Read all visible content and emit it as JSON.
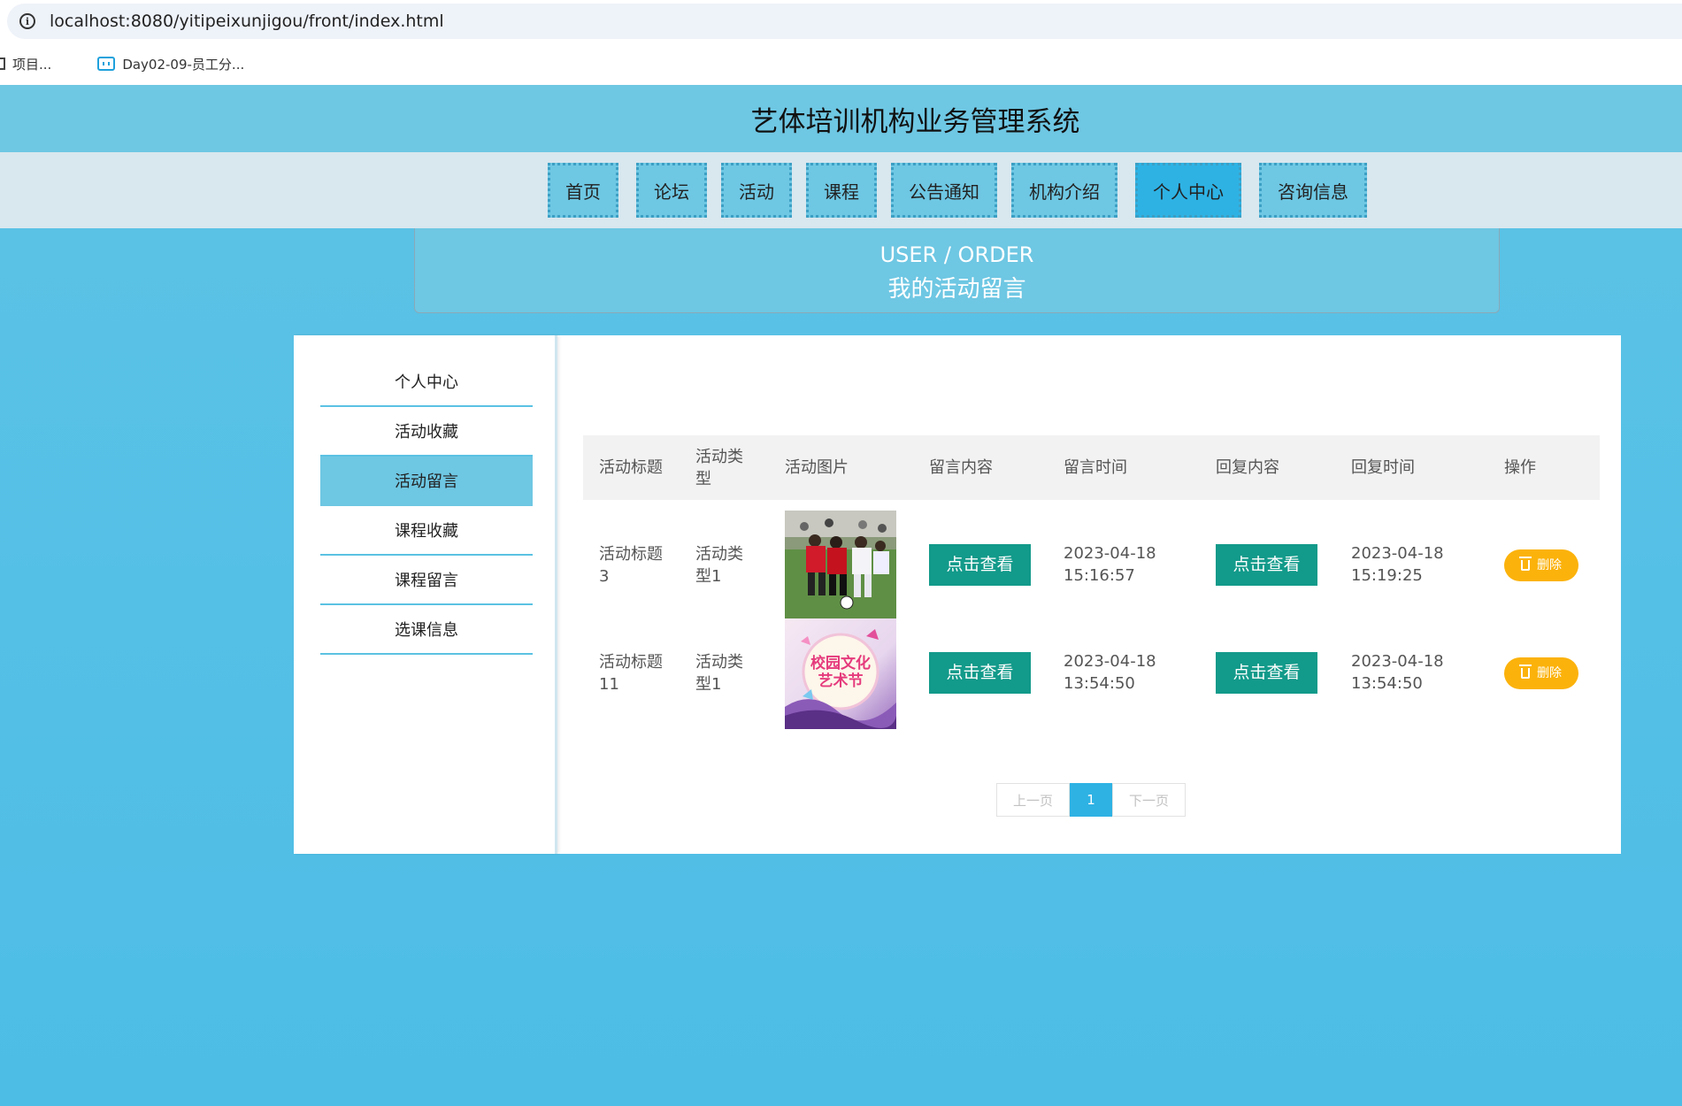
{
  "browser": {
    "url": "localhost:8080/yitipeixunjigou/front/index.html",
    "bookmarks": [
      "项目...",
      "Day02-09-员工分..."
    ]
  },
  "header": {
    "title": "艺体培训机构业务管理系统"
  },
  "nav": {
    "items": [
      "首页",
      "论坛",
      "活动",
      "课程",
      "公告通知",
      "机构介绍",
      "个人中心",
      "咨询信息"
    ],
    "active": "个人中心"
  },
  "banner": {
    "en": "USER / ORDER",
    "cn": "我的活动留言"
  },
  "sidebar": {
    "items": [
      "个人中心",
      "活动收藏",
      "活动留言",
      "课程收藏",
      "课程留言",
      "选课信息"
    ],
    "active": "活动留言"
  },
  "table": {
    "headers": [
      "活动标题",
      "活动类型",
      "活动图片",
      "留言内容",
      "留言时间",
      "回复内容",
      "回复时间",
      "操作"
    ],
    "rows": [
      {
        "title": "活动标题3",
        "type": "活动类型1",
        "image": "football-match-photo",
        "content_button": "点击查看",
        "comment_time": "2023-04-18 15:16:57",
        "reply_button": "点击查看",
        "reply_time": "2023-04-18 15:19:25",
        "delete_label": "删除"
      },
      {
        "title": "活动标题11",
        "type": "活动类型1",
        "image": "campus-culture-art-festival-poster",
        "image_text": "校园文化艺术节",
        "content_button": "点击查看",
        "comment_time": "2023-04-18 13:54:50",
        "reply_button": "点击查看",
        "reply_time": "2023-04-18 13:54:50",
        "delete_label": "删除"
      }
    ]
  },
  "pager": {
    "prev": "上一页",
    "current": "1",
    "next": "下一页"
  },
  "colors": {
    "header": "#6ec7e3",
    "active_nav": "#2eb2e4",
    "view_button": "#129a8a",
    "delete_button": "#fbb20b"
  }
}
